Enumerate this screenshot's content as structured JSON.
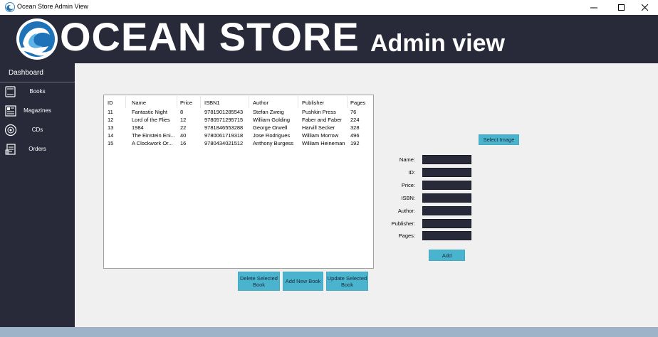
{
  "window": {
    "title": "Ocean Store Admin View"
  },
  "header": {
    "brand": "OCEAN STORE",
    "subtitle": "Admin view"
  },
  "sidebar": {
    "dashboard": "Dashboard",
    "items": [
      {
        "label": "Books",
        "icon": "book-icon"
      },
      {
        "label": "Magazines",
        "icon": "magazine-icon"
      },
      {
        "label": "CDs",
        "icon": "cd-icon"
      },
      {
        "label": "Orders",
        "icon": "orders-icon"
      }
    ]
  },
  "table": {
    "columns": [
      "ID",
      "Name",
      "Price",
      "ISBN1",
      "Author",
      "Publisher",
      "Pages"
    ],
    "rows": [
      [
        "11",
        "Fantastic Night",
        "8",
        "9781901285543",
        "Stefan Zweig",
        "Pushkin Press",
        "76"
      ],
      [
        "12",
        "Lord of the Flies",
        "12",
        "9780571295715",
        "William Golding",
        "Faber and Faber",
        "224"
      ],
      [
        "13",
        "1984",
        "22",
        "9781846553288",
        "George Orwell",
        "Harvill Secker",
        "328"
      ],
      [
        "14",
        "The Einstein Eni...",
        "40",
        "9780061719318",
        "Jose Rodrigues",
        "William Morrow",
        "496"
      ],
      [
        "15",
        "A Clockwork Or...",
        "16",
        "9780434021512",
        "Anthony Burgess",
        "William Heineman",
        "192"
      ]
    ]
  },
  "actions": {
    "delete": "Delete Selected Book",
    "add_new": "Add New Book",
    "update": "Update Selected Book"
  },
  "form": {
    "select_image": "Select Image",
    "labels": {
      "name": "Name:",
      "id": "ID:",
      "price": "Price:",
      "isbn": "ISBN:",
      "author": "Author:",
      "publisher": "Publisher:",
      "pages": "Pages:"
    },
    "add": "Add"
  },
  "colors": {
    "dark": "#282a3a",
    "accent": "#4ab3cd",
    "bottom_bar": "#9fb3c8"
  }
}
